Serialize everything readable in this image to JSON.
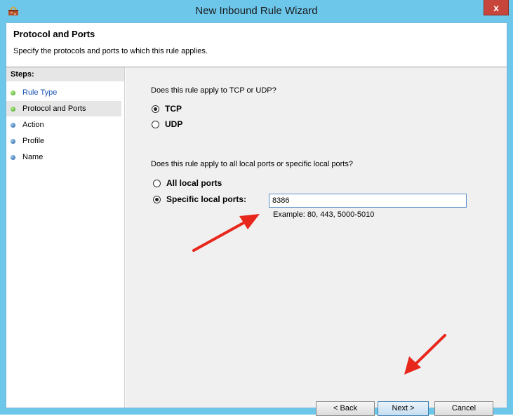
{
  "window": {
    "title": "New Inbound Rule Wizard",
    "close_glyph": "x"
  },
  "header": {
    "title": "Protocol and Ports",
    "description": "Specify the protocols and ports to which this rule applies."
  },
  "steps": {
    "title": "Steps:",
    "items": [
      {
        "label": "Rule Type",
        "status": "done"
      },
      {
        "label": "Protocol and Ports",
        "status": "current"
      },
      {
        "label": "Action",
        "status": "pending"
      },
      {
        "label": "Profile",
        "status": "pending"
      },
      {
        "label": "Name",
        "status": "pending"
      }
    ]
  },
  "protocol": {
    "question": "Does this rule apply to TCP or UDP?",
    "options": [
      {
        "label": "TCP",
        "selected": true
      },
      {
        "label": "UDP",
        "selected": false
      }
    ]
  },
  "ports": {
    "question": "Does this rule apply to all local ports or specific local ports?",
    "options": [
      {
        "label": "All local ports",
        "selected": false
      },
      {
        "label": "Specific local ports:",
        "selected": true
      }
    ],
    "value": "8386",
    "example": "Example: 80, 443, 5000-5010"
  },
  "buttons": {
    "back": "< Back",
    "next": "Next >",
    "cancel": "Cancel"
  },
  "colors": {
    "title_bar": "#6cc7eb",
    "close_button": "#c7453a",
    "annotation_arrow": "#e8271c"
  }
}
